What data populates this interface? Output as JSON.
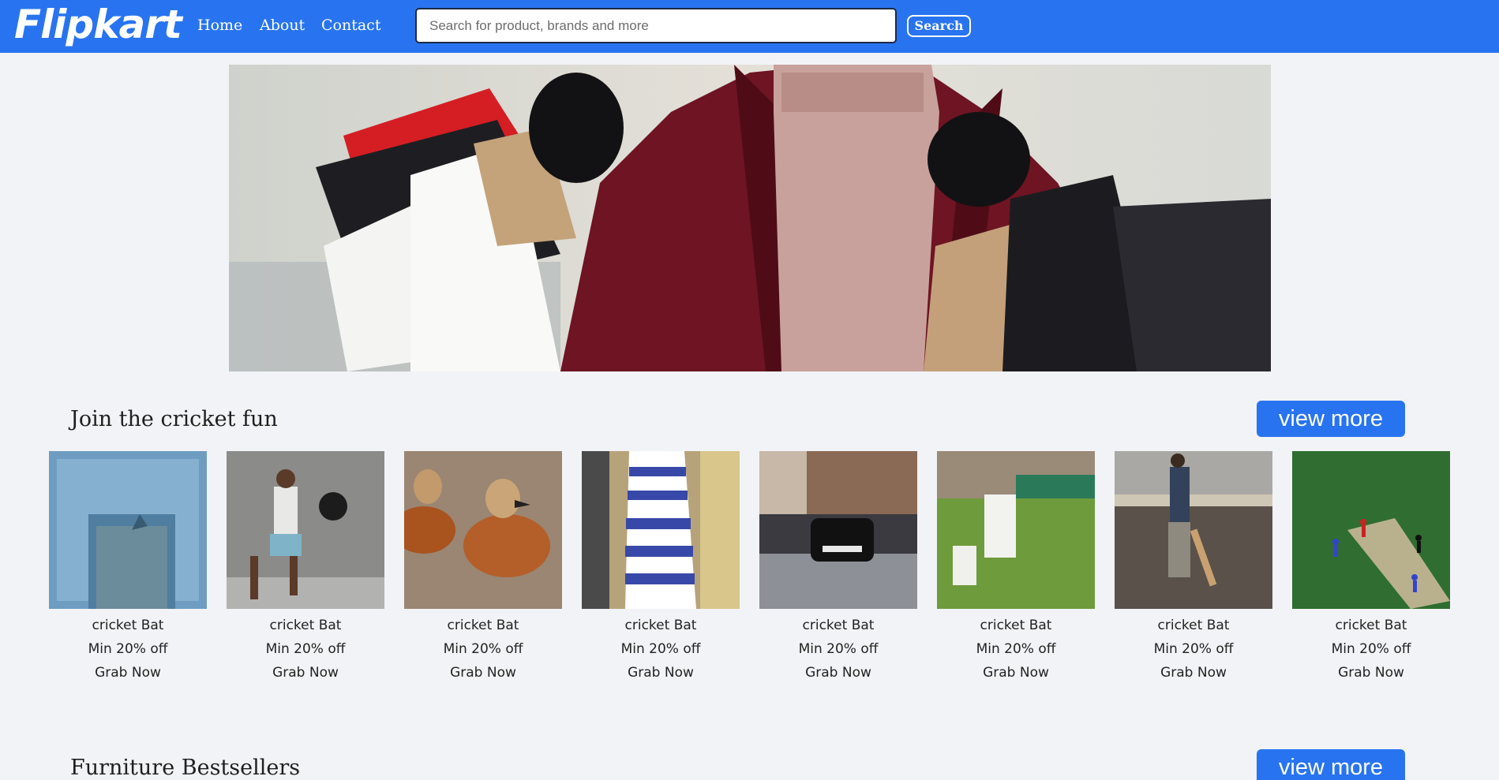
{
  "header": {
    "logo": "Flipkart",
    "nav": [
      {
        "label": "Home"
      },
      {
        "label": "About"
      },
      {
        "label": "Contact"
      }
    ],
    "search": {
      "placeholder": "Search for product, brands and more",
      "value": ""
    },
    "search_button": "Search",
    "brand_color": "#2874f0"
  },
  "banner": {
    "description_icon": "shopping-banner-image"
  },
  "sections": [
    {
      "title": "Join the cricket fun",
      "view_more": "view more",
      "products": [
        {
          "name": "cricket Bat",
          "discount": "Min 20% off",
          "cta": "Grab Now"
        },
        {
          "name": "cricket Bat",
          "discount": "Min 20% off",
          "cta": "Grab Now"
        },
        {
          "name": "cricket Bat",
          "discount": "Min 20% off",
          "cta": "Grab Now"
        },
        {
          "name": "cricket Bat",
          "discount": "Min 20% off",
          "cta": "Grab Now"
        },
        {
          "name": "cricket Bat",
          "discount": "Min 20% off",
          "cta": "Grab Now"
        },
        {
          "name": "cricket Bat",
          "discount": "Min 20% off",
          "cta": "Grab Now"
        },
        {
          "name": "cricket Bat",
          "discount": "Min 20% off",
          "cta": "Grab Now"
        },
        {
          "name": "cricket Bat",
          "discount": "Min 20% off",
          "cta": "Grab Now"
        }
      ]
    },
    {
      "title": "Furniture Bestsellers",
      "view_more": "view more"
    }
  ]
}
